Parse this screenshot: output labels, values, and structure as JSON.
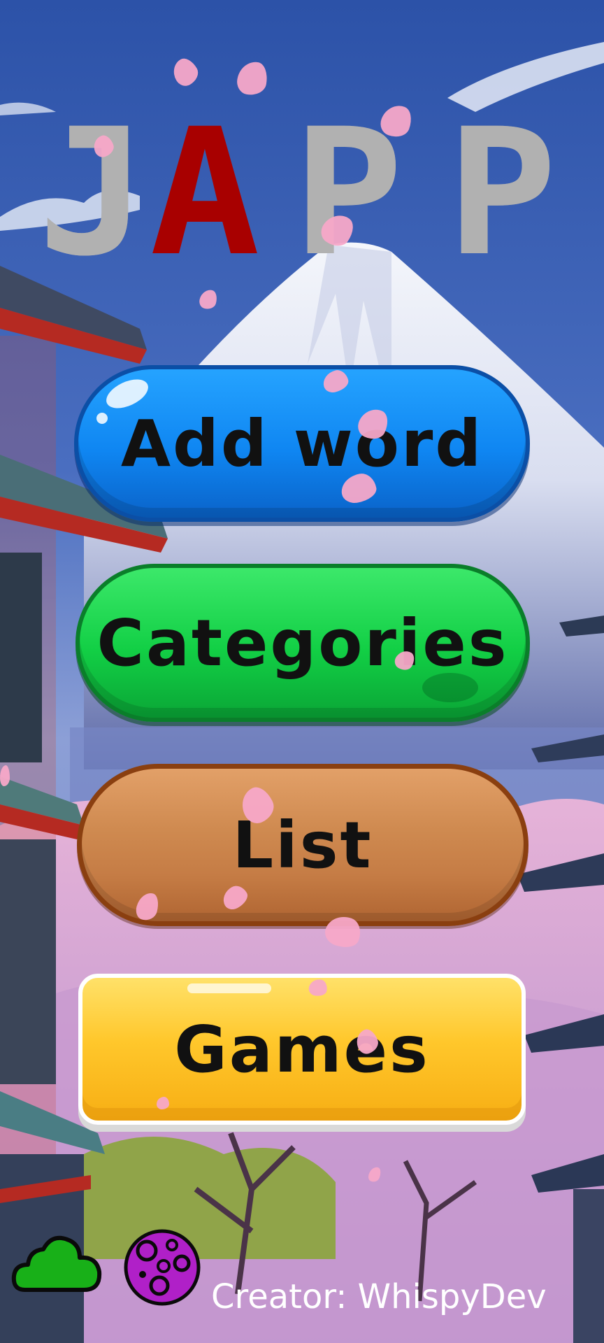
{
  "title": {
    "letters": [
      "J",
      "A",
      "P",
      "P"
    ],
    "accent_letter_color": "#a80000",
    "letter_color": "#b1b1b1"
  },
  "menu": {
    "add_word": "Add word",
    "categories": "Categories",
    "list": "List",
    "games": "Games"
  },
  "button_colors": {
    "add_word": "#0f86f2",
    "categories": "#12cf45",
    "list": "#c57c45",
    "games": "#ffc72b"
  },
  "footer": {
    "cloud_icon": "cloud-icon",
    "planet_icon": "planet-icon",
    "creator": "Creator: WhispyDev"
  },
  "background": {
    "theme": "mount-fuji-pagoda-cherry-blossom",
    "sky_color": "#3e62b4",
    "petal_color": "#f7a8c8"
  }
}
